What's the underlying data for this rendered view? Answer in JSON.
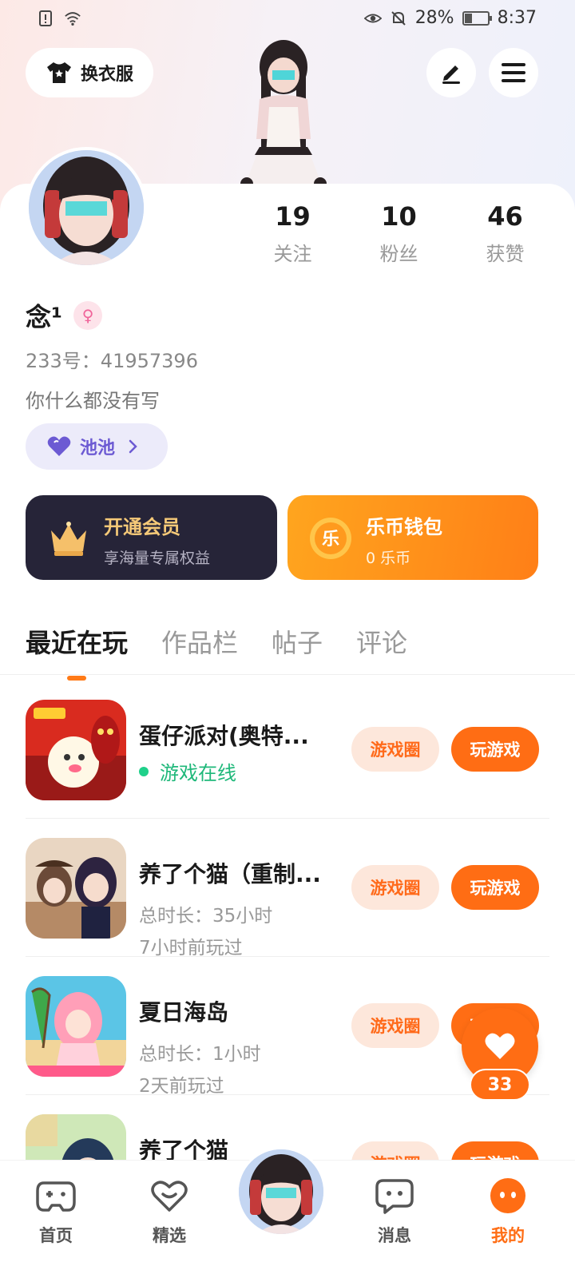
{
  "status_bar": {
    "battery": "28%",
    "time": "8:37"
  },
  "header": {
    "outfit_label": "换衣服"
  },
  "profile": {
    "stats": [
      {
        "num": "19",
        "label": "关注"
      },
      {
        "num": "10",
        "label": "粉丝"
      },
      {
        "num": "46",
        "label": "获赞"
      }
    ],
    "name": "念¹",
    "gender_symbol": "♀",
    "uid": "233号：41957396",
    "bio": "你什么都没有写",
    "tag_label": "池池"
  },
  "cards": {
    "vip_title": "开通会员",
    "vip_sub": "享海量专属权益",
    "wallet_title": "乐币钱包",
    "wallet_sub": "0 乐币",
    "wallet_coin_char": "乐"
  },
  "tabs": [
    {
      "label": "最近在玩",
      "active": true
    },
    {
      "label": "作品栏",
      "active": false
    },
    {
      "label": "帖子",
      "active": false
    },
    {
      "label": "评论",
      "active": false
    }
  ],
  "games": [
    {
      "name": "蛋仔派对(奥特...",
      "online": "游戏在线",
      "circle": "游戏圈",
      "play": "玩游戏"
    },
    {
      "name": "养了个猫（重制...",
      "meta1": "总时长：35小时",
      "meta2": "7小时前玩过",
      "circle": "游戏圈",
      "play": "玩游戏"
    },
    {
      "name": "夏日海岛",
      "meta1": "总时长：1小时",
      "meta2": "2天前玩过",
      "circle": "游戏圈",
      "play": "玩游戏"
    },
    {
      "name": "养了个猫",
      "circle": "游戏圈",
      "play": "玩游戏"
    }
  ],
  "float_like": {
    "count": "33"
  },
  "nav": {
    "home": "首页",
    "featured": "精选",
    "messages": "消息",
    "mine": "我的"
  },
  "colors": {
    "accent": "#ff6d14",
    "vip_bg": "#262438",
    "online": "#1fb87a"
  }
}
